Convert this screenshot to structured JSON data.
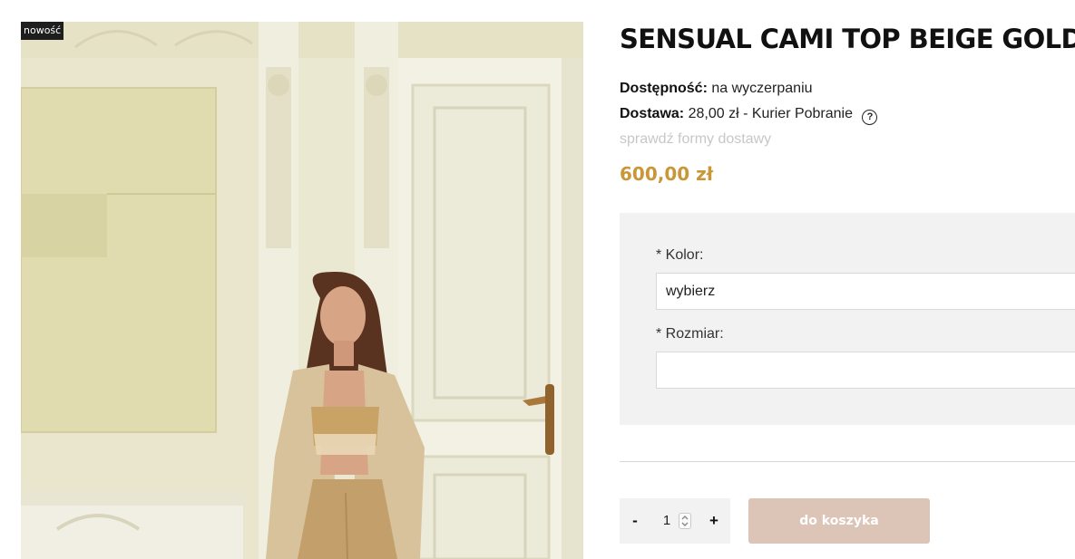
{
  "product": {
    "badge": "nowość",
    "title": "SENSUAL CAMI TOP BEIGE GOLD",
    "availability_label": "Dostępność:",
    "availability_value": "na wyczerpaniu",
    "shipping_label": "Dostawa:",
    "shipping_value": "28,00 zł - Kurier Pobranie",
    "help_icon": "question-circle-icon",
    "help_glyph": "?",
    "shipping_link": "sprawdź formy dostawy",
    "price": "600,00 zł",
    "price_color": "#c99638"
  },
  "options": {
    "color_label": "* Kolor:",
    "color_value": "wybierz",
    "size_label": "* Rozmiar:",
    "size_value": ""
  },
  "cart": {
    "minus": "-",
    "quantity": "1",
    "plus": "+",
    "button_label": "do koszyka",
    "button_color": "#dcc5b7"
  }
}
